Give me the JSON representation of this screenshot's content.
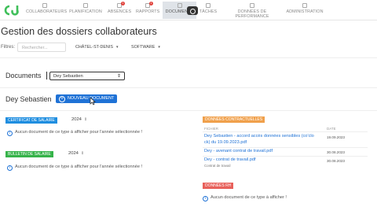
{
  "nav": {
    "items": [
      {
        "label": "COLLABORATEURS",
        "icon": "users-icon",
        "badge": ""
      },
      {
        "label": "PLANIFICATION",
        "icon": "calendar-icon",
        "badge": ""
      },
      {
        "label": "ABSENCES",
        "icon": "absences-icon",
        "badge": "1"
      },
      {
        "label": "RAPPORTS",
        "icon": "reports-icon",
        "badge": "1"
      },
      {
        "label": "DOCUMENTS",
        "icon": "folder-icon",
        "badge": ""
      },
      {
        "label": "TÂCHES",
        "icon": "tasks-icon",
        "badge": ""
      },
      {
        "label": "DONNÉES DE PERFORMANCE",
        "icon": "performance-icon",
        "badge": ""
      },
      {
        "label": "ADMINISTRATION",
        "icon": "admin-icon",
        "badge": ""
      }
    ],
    "active_index": 4
  },
  "page": {
    "title": "Gestion des dossiers collaborateurs"
  },
  "filters": {
    "label": "Filtres:",
    "search_placeholder": "Rechercher...",
    "location": "CHÂTEL-ST-DENIS",
    "software": "SOFTWARE"
  },
  "documents": {
    "label": "Documents",
    "selected_person": "Dey Sebastien"
  },
  "person": {
    "name": "Dey Sebastien",
    "new_document_label": "NOUVEAU DOCUMENT"
  },
  "sections": {
    "certificat": {
      "tag": "CERTIFICAT DE SALAIRE",
      "tag_color": "#1f8ee0",
      "year": "2024",
      "empty": "Aucun document de ce type à afficher pour l'année sélectionnée !"
    },
    "bulletin": {
      "tag": "BULLETIN DE SALAIRE",
      "tag_color": "#36b34a",
      "year": "2024",
      "empty": "Aucun document de ce type à afficher pour l'année sélectionnée !"
    },
    "contractuelles": {
      "tag": "DONNÉES CONTRACTUELLES",
      "tag_color": "#f0a04b",
      "col_file": "FICHIER",
      "col_date": "DATE",
      "rows": [
        {
          "file_line1": "Dey Sebastien - accord accès données sensibles (co'clo",
          "file_line2": "ck) du 19.09.2023.pdf",
          "sub": "",
          "date": "19.09.2023"
        },
        {
          "file_line1": "Dey - avenant contrat de travail.pdf",
          "file_line2": "",
          "sub": "",
          "date": "30.08.2023"
        },
        {
          "file_line1": "Dey - contrat de travail.pdf",
          "file_line2": "",
          "sub": "Contrat de travail",
          "date": "30.08.2023"
        }
      ]
    },
    "rh": {
      "tag": "DONNÉES RH",
      "tag_color": "#e8605a",
      "empty": "Aucun document de ce type à afficher !"
    }
  }
}
